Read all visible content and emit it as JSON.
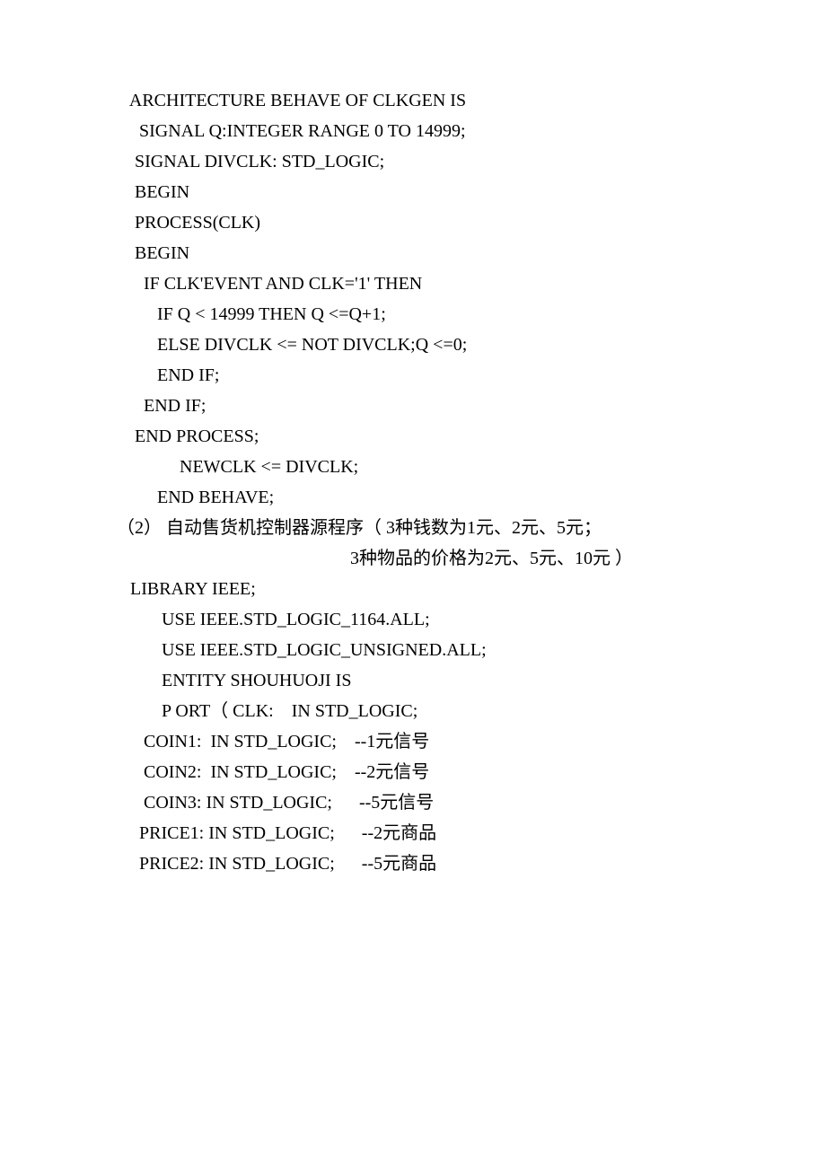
{
  "lines": [
    {
      "indent": 0,
      "text": "   ARCHITECTURE BEHAVE OF CLKGEN IS"
    },
    {
      "indent": 0,
      "text": "     SIGNAL Q:INTEGER RANGE 0 TO 14999;"
    },
    {
      "indent": 0,
      "text": "    SIGNAL DIVCLK: STD_LOGIC;"
    },
    {
      "indent": 0,
      "text": "    BEGIN"
    },
    {
      "indent": 0,
      "text": "    PROCESS(CLK)"
    },
    {
      "indent": 0,
      "text": "    BEGIN"
    },
    {
      "indent": 0,
      "text": "      IF CLK'EVENT AND CLK='1' THEN"
    },
    {
      "indent": 0,
      "text": "         IF Q < 14999 THEN Q <=Q+1;"
    },
    {
      "indent": 0,
      "text": "         ELSE DIVCLK <= NOT DIVCLK;Q <=0;"
    },
    {
      "indent": 0,
      "text": "         END IF;"
    },
    {
      "indent": 0,
      "text": "      END IF;"
    },
    {
      "indent": 0,
      "text": "    END PROCESS;"
    },
    {
      "indent": 0,
      "text": "              NEWCLK <= DIVCLK;"
    },
    {
      "indent": 0,
      "text": "         END BEHAVE;"
    },
    {
      "indent": 0,
      "text": "（2） 自动售货机控制器源程序（ 3种钱数为1元、2元、5元；"
    },
    {
      "indent": 0,
      "text": "                                                    3种物品的价格为2元、5元、10元 ）"
    },
    {
      "indent": 0,
      "text": "   LIBRARY IEEE;"
    },
    {
      "indent": 0,
      "text": "          USE IEEE.STD_LOGIC_1164.ALL;"
    },
    {
      "indent": 0,
      "text": "          USE IEEE.STD_LOGIC_UNSIGNED.ALL;"
    },
    {
      "indent": 0,
      "text": "          ENTITY SHOUHUOJI IS"
    },
    {
      "indent": 0,
      "text": "          P ORT（ CLK:    IN STD_LOGIC;"
    },
    {
      "indent": 0,
      "text": "      COIN1:  IN STD_LOGIC;    --1元信号"
    },
    {
      "indent": 0,
      "text": "      COIN2:  IN STD_LOGIC;    --2元信号"
    },
    {
      "indent": 0,
      "text": "      COIN3: IN STD_LOGIC;      --5元信号"
    },
    {
      "indent": 0,
      "text": "     PRICE1: IN STD_LOGIC;      --2元商品"
    },
    {
      "indent": 0,
      "text": "     PRICE2: IN STD_LOGIC;      --5元商品"
    }
  ]
}
